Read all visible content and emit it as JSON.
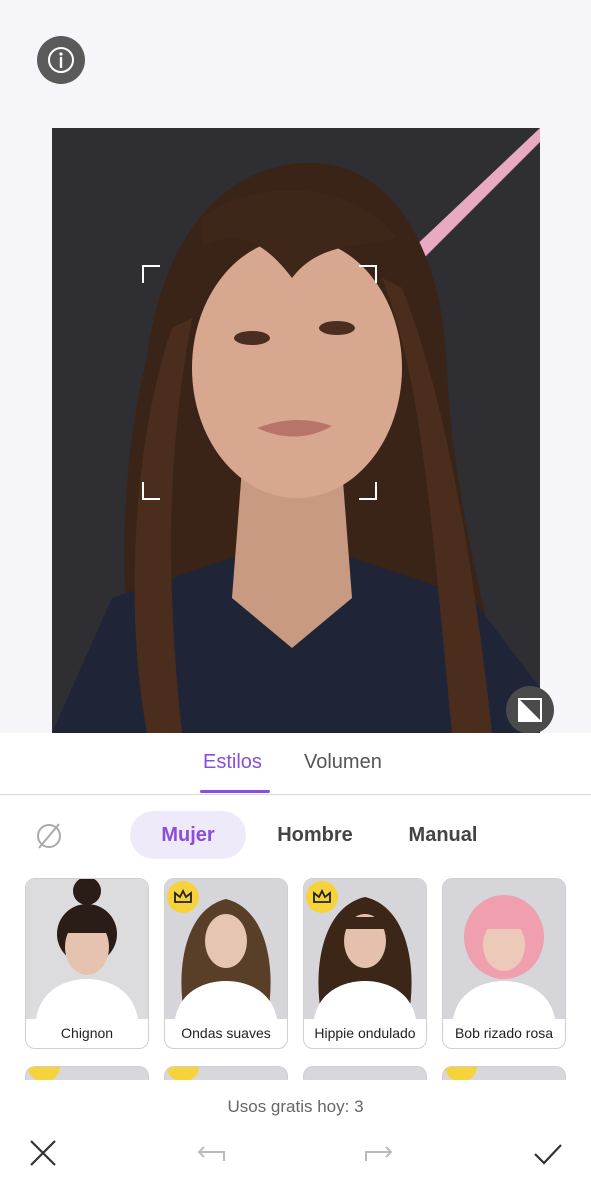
{
  "tabs": [
    {
      "label": "Estilos",
      "active": true
    },
    {
      "label": "Volumen",
      "active": false
    }
  ],
  "segments": [
    {
      "label": "Mujer",
      "active": true
    },
    {
      "label": "Hombre",
      "active": false
    },
    {
      "label": "Manual",
      "active": false
    }
  ],
  "styles": [
    {
      "label": "Chignon",
      "premium": false
    },
    {
      "label": "Ondas suaves",
      "premium": true
    },
    {
      "label": "Hippie ondulado",
      "premium": true
    },
    {
      "label": "Bob rizado rosa",
      "premium": false
    }
  ],
  "free_uses": "Usos gratis hoy: 3",
  "icons": [
    "info-icon",
    "compare-icon",
    "no-style-icon",
    "crown-icon",
    "close-icon",
    "undo-icon",
    "redo-icon",
    "check-icon"
  ],
  "colors": {
    "accent": "#8a4fd8",
    "crown": "#f7d33b"
  }
}
